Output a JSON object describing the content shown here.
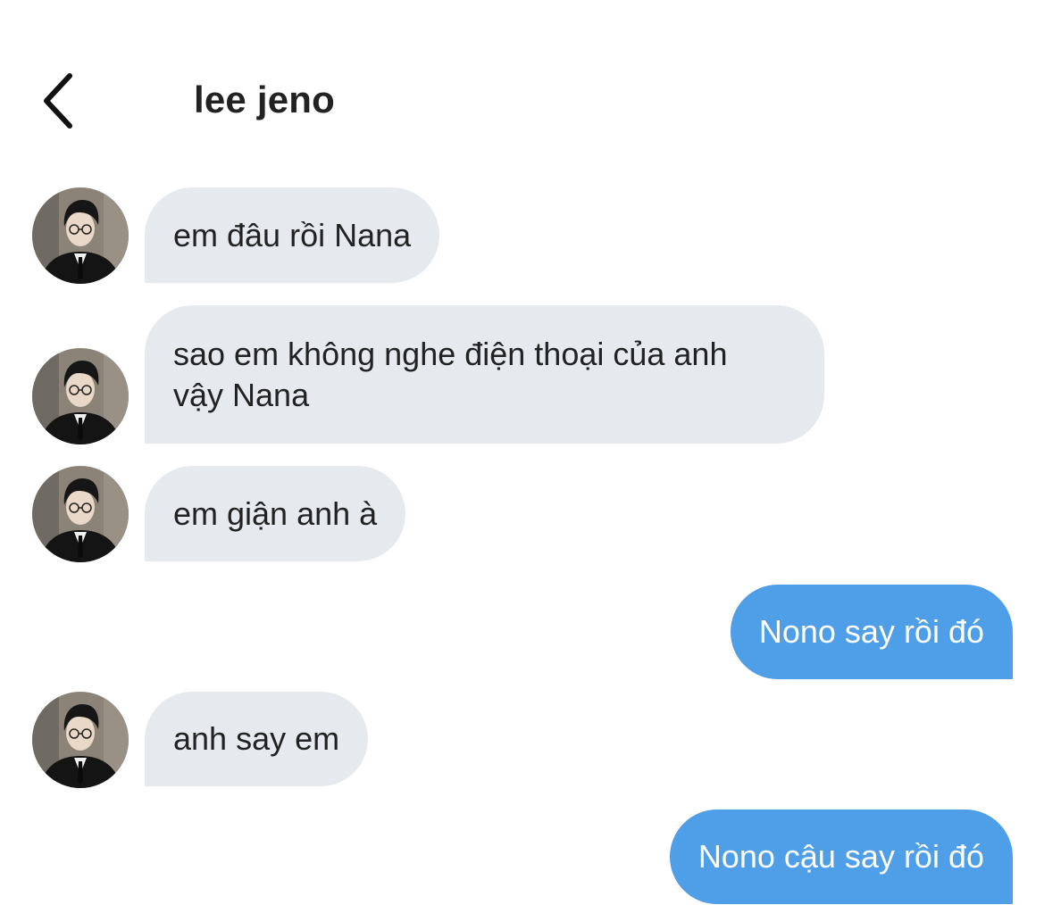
{
  "header": {
    "back_icon": "chevron-left-icon",
    "title": "lee jeno"
  },
  "contact": {
    "avatar_icon": "avatar-photo-icon"
  },
  "messages": [
    {
      "sender": "contact",
      "text": "em đâu rồi Nana"
    },
    {
      "sender": "contact",
      "text": "sao em không nghe điện thoại của anh vậy Nana"
    },
    {
      "sender": "contact",
      "text": "em giận anh à"
    },
    {
      "sender": "me",
      "text": "Nono say rồi đó"
    },
    {
      "sender": "contact",
      "text": "anh say em"
    },
    {
      "sender": "me",
      "text": "Nono cậu say rồi đó"
    }
  ],
  "colors": {
    "incoming_bubble": "#e6eaee",
    "outgoing_bubble": "#4e9ee8",
    "outgoing_text": "#ffffff",
    "text": "#222222"
  }
}
